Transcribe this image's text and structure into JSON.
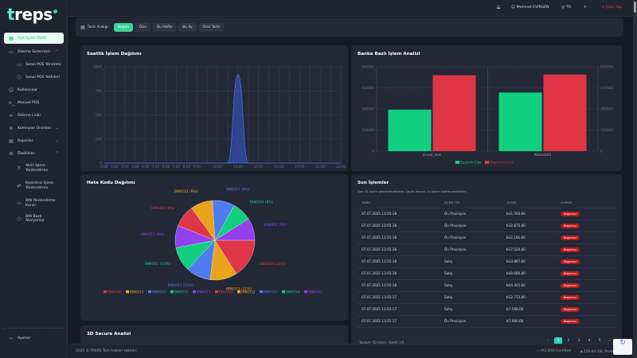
{
  "brand": {
    "logo": "treps"
  },
  "sidebar": {
    "items": [
      {
        "label": "Üye İşyeri Özeti",
        "icon": "dashboard-icon",
        "active": true
      },
      {
        "label": "Ödeme Sistemleri",
        "icon": "card-icon",
        "expanded": true
      },
      {
        "label": "Sanal POS Yönetimi",
        "icon": "card-icon",
        "sub": true
      },
      {
        "label": "Sanal POS Yetkileri",
        "icon": "shield-icon",
        "sub": true
      },
      {
        "label": "Kullanıcılar",
        "icon": "users-icon"
      },
      {
        "label": "Manuel POS",
        "icon": "terminal-icon"
      },
      {
        "label": "Ödeme Linki",
        "icon": "link-icon"
      },
      {
        "label": "Komisyon Oranları",
        "icon": "percent-icon",
        "collapsed": true
      },
      {
        "label": "Raporlar",
        "icon": "report-icon",
        "collapsed": true
      },
      {
        "label": "Özellikler",
        "icon": "gear-icon",
        "expanded": true
      },
      {
        "label": "Akıllı İşlem Yönlendirme",
        "icon": "route-icon",
        "sub": true
      },
      {
        "label": "Kesintisiz İşlem Yönlendirme",
        "icon": "swap-icon",
        "sub": true
      },
      {
        "label": "BIN Yönlendirme Kuralı",
        "icon": "card-icon",
        "sub": true
      },
      {
        "label": "BIN Bazlı Aksiyonlar",
        "icon": "hexagon-icon",
        "sub": true
      }
    ],
    "settings": "Ayarlar"
  },
  "header": {
    "user": "Mehmet EVİRGEN",
    "lang": "TR",
    "logout": "Çıkış Yap"
  },
  "filter": {
    "label": "Tarih Aralığı:",
    "buttons": [
      "Bugün",
      "Dün",
      "Bu Hafta",
      "Bu Ay",
      "Özel Tarih"
    ],
    "active": "Bugün"
  },
  "cards": {
    "hourly": "Saatlik İşlem Dağılımı",
    "bank": "Banka Bazlı İşlem Analizi",
    "errors": "Hata Kodu Dağılımı",
    "recent": "Son İşlemler",
    "secure3d": "3D Secure Analizi"
  },
  "chart_data": [
    {
      "type": "area",
      "title": "Saatlik İşlem Dağılımı",
      "x": [
        "0:00",
        "1:00",
        "2:00",
        "3:00",
        "4:00",
        "5:00",
        "6:00",
        "7:00",
        "8:00",
        "9:00",
        "10:00",
        "11:00",
        "12:00",
        "13:00",
        "14:00",
        "15:00",
        "16:00",
        "17:00",
        "18:00",
        "19:00",
        "20:00",
        "21:00",
        "22:00",
        "23:00"
      ],
      "tick_labels": [
        "0:00",
        "1:00",
        "2:00",
        "3:00",
        "4:00",
        "5:00",
        "6:00",
        "7:00",
        "8:00",
        "9:00",
        "11:00",
        "13:00",
        "15:00",
        "17:00",
        "19:00",
        "21:00",
        "23:00"
      ],
      "values": [
        0,
        0,
        0,
        0,
        0,
        0,
        0,
        0,
        0,
        0,
        0,
        0,
        0,
        920,
        0,
        0,
        0,
        0,
        0,
        0,
        0,
        0,
        0,
        0
      ],
      "yticks": [
        0,
        250,
        500,
        750,
        1000
      ],
      "ylim": [
        0,
        1000
      ],
      "grid": true,
      "color": "#3b5bdb"
    },
    {
      "type": "bar",
      "title": "Banka Bazlı İşlem Analizi",
      "categories": [
        "ziraat_test",
        "Akbank01"
      ],
      "series": [
        {
          "name": "Başarılı Ciro",
          "values": [
            295000,
            417000
          ],
          "color": "#10d07f"
        },
        {
          "name": "Başarısız Ciro",
          "values": [
            540000,
            545000
          ],
          "color": "#e03545"
        }
      ],
      "yticks": [
        0,
        150000,
        300000,
        450000,
        600000
      ],
      "ylim": [
        0,
        600000
      ],
      "legend": "bottom",
      "grid": true
    },
    {
      "type": "pie",
      "title": "Hata Kodu Dağılımı",
      "slices": [
        {
          "label": "BNK099",
          "pct": 16,
          "color": "#e03545"
        },
        {
          "label": "BNK013",
          "pct": 11,
          "color": "#eaa31a"
        },
        {
          "label": "BNK003",
          "pct": 10,
          "color": "#4f7bf0"
        },
        {
          "label": "BNK051",
          "pct": 10,
          "color": "#10d07f"
        },
        {
          "label": "BNK021",
          "pct": 9,
          "color": "#9340ee"
        },
        {
          "label": "BNK063",
          "pct": 9,
          "color": "#e03545"
        },
        {
          "label": "BNK012",
          "pct": 9,
          "color": "#eaa31a"
        },
        {
          "label": "BNK057",
          "pct": 9,
          "color": "#4f7bf0"
        },
        {
          "label": "BNK054",
          "pct": 8,
          "color": "#10d07f"
        },
        {
          "label": "BNK001",
          "pct": 9,
          "color": "#9340ee"
        }
      ],
      "legend": "bottom"
    }
  ],
  "recent": {
    "subtitle": "Son 50 işlem gösterilmektedir. Sayfa başına 10 işlem listelenmektedir.",
    "columns": [
      "TARİH",
      "İŞLEM TİPİ",
      "TUTAR",
      "DURUM"
    ],
    "rows": [
      [
        "07.07.2025 13:55:18",
        "Ön Provizyon",
        "₺31.760,00",
        "Başarısız"
      ],
      [
        "07.07.2025 13:55:18",
        "Ön Provizyon",
        "₺32.675,00",
        "Başarısız"
      ],
      [
        "07.07.2025 13:55:18",
        "Ön Provizyon",
        "₺22.191,00",
        "Başarısız"
      ],
      [
        "07.07.2025 13:55:18",
        "Ön Provizyon",
        "₺17.520,00",
        "Başarısız"
      ],
      [
        "07.07.2025 13:55:18",
        "Satış",
        "₺33.897,00",
        "Başarısız"
      ],
      [
        "07.07.2025 13:55:18",
        "Satış",
        "₺49.680,00",
        "Başarısız"
      ],
      [
        "07.07.2025 13:55:18",
        "Satış",
        "₺44.445,00",
        "Başarısız"
      ],
      [
        "07.07.2025 13:55:17",
        "Satış",
        "₺12.772,00",
        "Başarısız"
      ],
      [
        "07.07.2025 13:55:17",
        "Satış",
        "₺7.568,00",
        "Başarısız"
      ],
      [
        "07.07.2025 13:55:17",
        "Ön Provizyon",
        "₺7.980,00",
        "Başarısız"
      ]
    ],
    "total": "Toplam: 50 işlem · Sayfa 1/5",
    "pages": [
      "1",
      "2",
      "3",
      "4",
      "5"
    ],
    "current_page": "1"
  },
  "footer": {
    "copyright": "2025 © TREPS Tüm hakları saklıdır.",
    "pci": "PCI-DSS Certified",
    "ssl": "256-bit SSL Protected"
  },
  "colors": {
    "accent": "#2dd4bf",
    "danger": "#e03545",
    "success": "#10d07f"
  }
}
